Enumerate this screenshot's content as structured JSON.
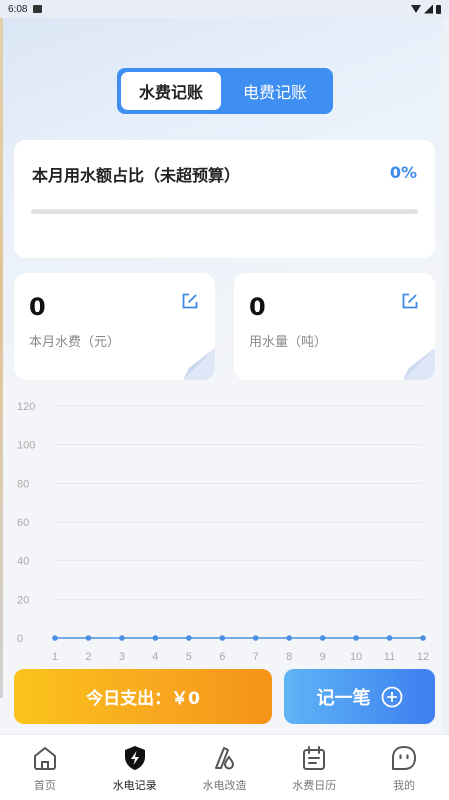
{
  "status_bar": {
    "time": "6:08"
  },
  "segment": {
    "tabs": [
      {
        "label": "水费记账",
        "active": true
      },
      {
        "label": "电费记账",
        "active": false
      }
    ]
  },
  "budget": {
    "title": "本月用水额占比（未超预算）",
    "percent_text": "0%",
    "progress": 0
  },
  "stats": [
    {
      "value": "0",
      "label": "本月水费（元）"
    },
    {
      "value": "0",
      "label": "用水量（吨）"
    }
  ],
  "chart_data": {
    "type": "line",
    "x": [
      1,
      2,
      3,
      4,
      5,
      6,
      7,
      8,
      9,
      10,
      11,
      12
    ],
    "values": [
      0,
      0,
      0,
      0,
      0,
      0,
      0,
      0,
      0,
      0,
      0,
      0
    ],
    "yticks": [
      0,
      20,
      40,
      60,
      80,
      100,
      120
    ],
    "ylim": [
      0,
      120
    ],
    "grid": true,
    "color": "#4a90e2"
  },
  "actions": {
    "today_label": "今日支出：￥0",
    "record_label": "记一笔"
  },
  "tab_bar": {
    "items": [
      {
        "label": "首页",
        "icon": "home-icon",
        "active": false
      },
      {
        "label": "水电记录",
        "icon": "lightning-shield-icon",
        "active": true
      },
      {
        "label": "水电改造",
        "icon": "pencil-drop-icon",
        "active": false
      },
      {
        "label": "水费日历",
        "icon": "calendar-icon",
        "active": false
      },
      {
        "label": "我的",
        "icon": "profile-icon",
        "active": false
      }
    ]
  }
}
